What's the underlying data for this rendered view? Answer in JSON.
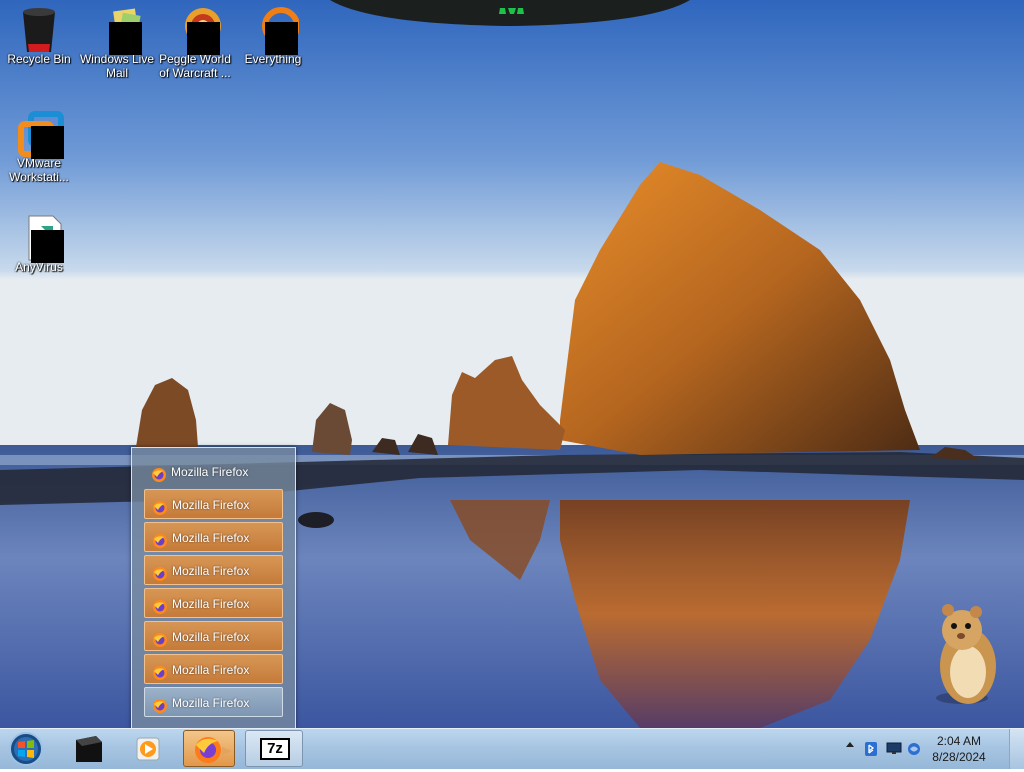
{
  "desktop_icons": [
    {
      "label": "Recycle Bin",
      "icon": "recycle-bin-icon"
    },
    {
      "label": "Windows Live Mail",
      "icon": "windows-live-mail-icon"
    },
    {
      "label": "Peggle World of Warcraft ...",
      "icon": "peggle-icon"
    },
    {
      "label": "Everything",
      "icon": "everything-search-icon"
    },
    {
      "label": "VMware Workstati...",
      "icon": "vmware-workstation-icon"
    },
    {
      "label": "AnyVirus",
      "icon": "anyvirus-icon"
    }
  ],
  "jumplist": {
    "header": "Mozilla Firefox",
    "items": [
      {
        "label": "Mozilla Firefox",
        "state": "orange"
      },
      {
        "label": "Mozilla Firefox",
        "state": "orange"
      },
      {
        "label": "Mozilla Firefox",
        "state": "orange"
      },
      {
        "label": "Mozilla Firefox",
        "state": "orange"
      },
      {
        "label": "Mozilla Firefox",
        "state": "orange"
      },
      {
        "label": "Mozilla Firefox",
        "state": "orange"
      },
      {
        "label": "Mozilla Firefox",
        "state": "selected"
      }
    ]
  },
  "taskbar": {
    "buttons": [
      "start-orb-icon",
      "black-app-icon",
      "media-player-icon",
      "firefox-icon",
      "7zip-icon"
    ],
    "sevenzip_label": "7z",
    "tray_icons": [
      "show-hidden-icons-arrow",
      "bluetooth-icon",
      "monitor-icon",
      "network-icon"
    ],
    "clock": {
      "time": "2:04 AM",
      "date": "8/28/2024"
    }
  },
  "colors": {
    "taskbar": "#a7c5e2",
    "jumplist_item": "#cf8a48",
    "jumplist_selected": "#8aa3bf",
    "sky_top": "#3f73c2"
  }
}
